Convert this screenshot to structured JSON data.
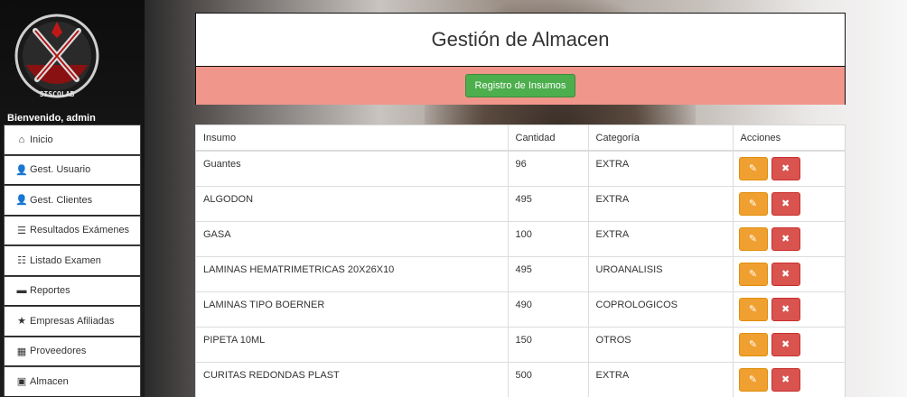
{
  "brand": {
    "logo_text": "SISCOLAB"
  },
  "welcome_text": "Bienvenido, admin",
  "nav": [
    {
      "label": "Inicio",
      "icon": "home-icon",
      "glyph": "⌂"
    },
    {
      "label": "Gest. Usuario",
      "icon": "user-icon",
      "glyph": "👤"
    },
    {
      "label": "Gest. Clientes",
      "icon": "user-icon",
      "glyph": "👤"
    },
    {
      "label": "Resultados Exámenes",
      "icon": "list-icon",
      "glyph": "☰"
    },
    {
      "label": "Listado Examen",
      "icon": "list-icon",
      "glyph": "☷"
    },
    {
      "label": "Reportes",
      "icon": "folder-icon",
      "glyph": "▬"
    },
    {
      "label": "Empresas Afiliadas",
      "icon": "star-icon",
      "glyph": "★"
    },
    {
      "label": "Proveedores",
      "icon": "cart-icon",
      "glyph": "▦"
    },
    {
      "label": "Almacen",
      "icon": "inbox-icon",
      "glyph": "▣"
    }
  ],
  "header": {
    "title": "Gestión de Almacen",
    "register_button": "Registro de Insumos"
  },
  "table": {
    "columns": [
      "Insumo",
      "Cantidad",
      "Categoría",
      "Acciones"
    ],
    "rows": [
      {
        "insumo": "Guantes",
        "cantidad": "96",
        "categoria": "EXTRA"
      },
      {
        "insumo": "ALGODON",
        "cantidad": "495",
        "categoria": "EXTRA"
      },
      {
        "insumo": "GASA",
        "cantidad": "100",
        "categoria": "EXTRA"
      },
      {
        "insumo": "LAMINAS HEMATRIMETRICAS 20X26X10",
        "cantidad": "495",
        "categoria": "UROANALISIS"
      },
      {
        "insumo": "LAMINAS TIPO BOERNER",
        "cantidad": "490",
        "categoria": "COPROLOGICOS"
      },
      {
        "insumo": "PIPETA 10ML",
        "cantidad": "150",
        "categoria": "OTROS"
      },
      {
        "insumo": "CURITAS REDONDAS PLAST",
        "cantidad": "500",
        "categoria": "EXTRA"
      }
    ],
    "edit_glyph": "✎",
    "delete_glyph": "✖"
  },
  "colors": {
    "action_bar": "#f0968a",
    "register_button": "#4cae4c",
    "edit_button": "#f0a030",
    "delete_button": "#d9534f"
  }
}
